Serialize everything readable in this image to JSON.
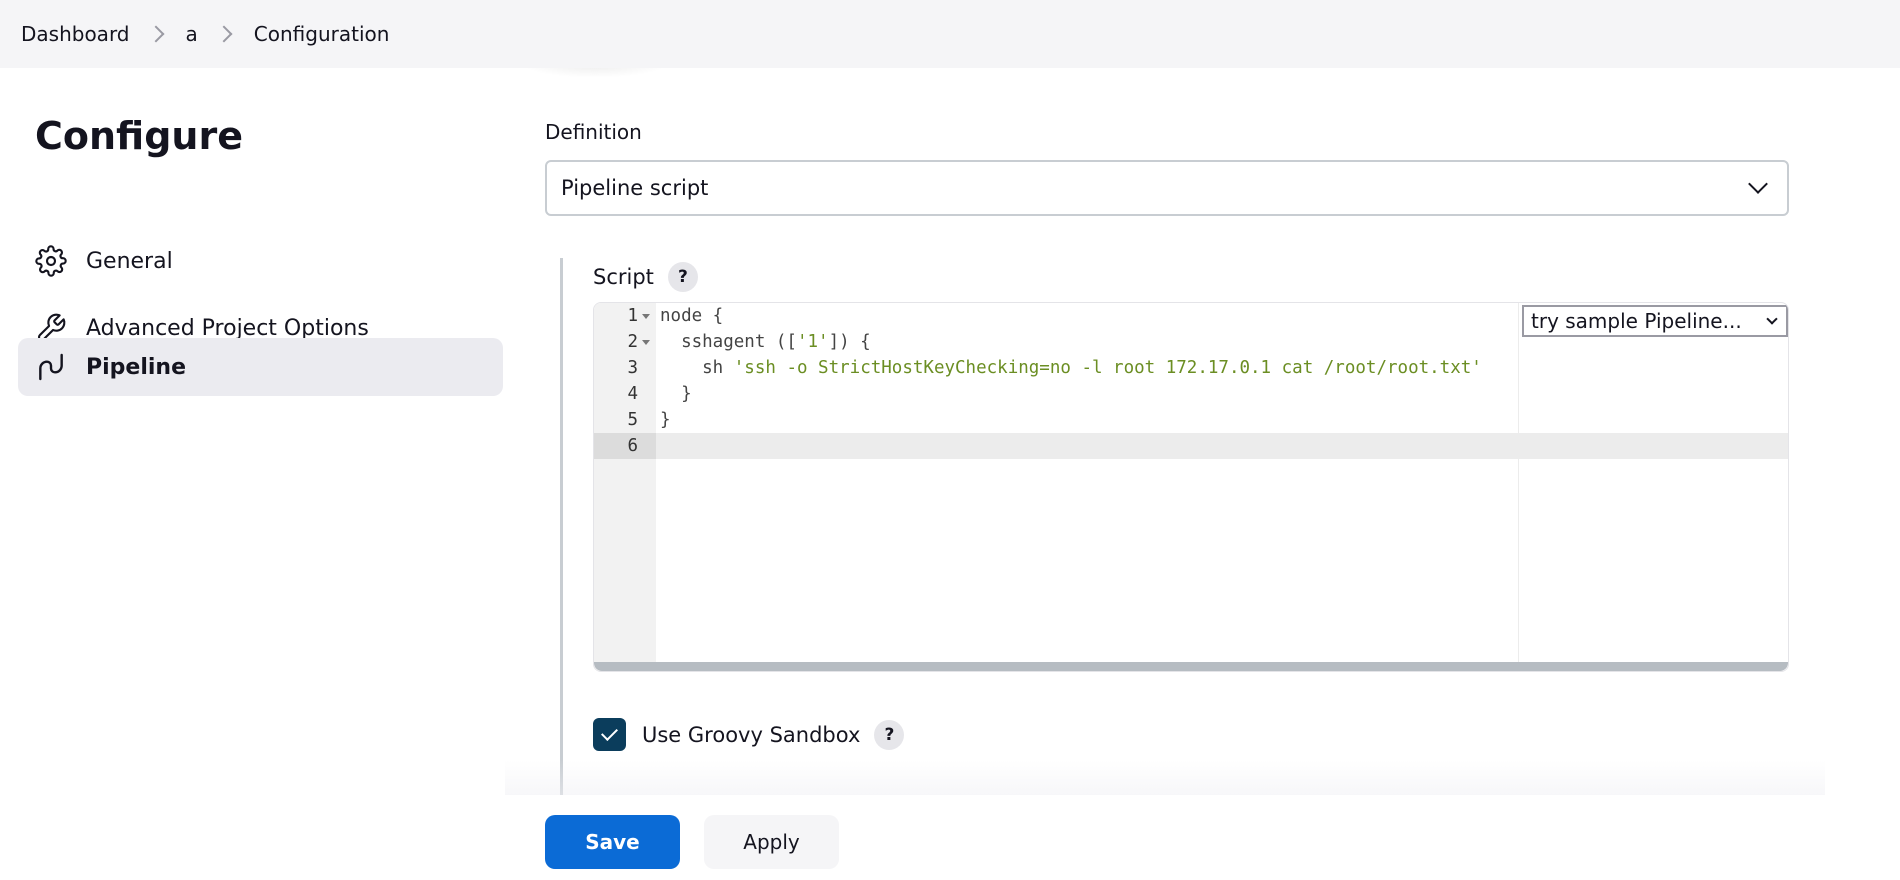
{
  "breadcrumb": {
    "items": [
      {
        "label": "Dashboard"
      },
      {
        "label": "a"
      },
      {
        "label": "Configuration"
      }
    ]
  },
  "sidebar": {
    "title": "Configure",
    "items": [
      {
        "label": "General",
        "icon": "gear-icon",
        "active": false
      },
      {
        "label": "Advanced Project Options",
        "icon": "wrench-icon",
        "active": false
      },
      {
        "label": "Pipeline",
        "icon": "pipeline-icon",
        "active": true
      }
    ]
  },
  "definition": {
    "label": "Definition",
    "selected": "Pipeline script"
  },
  "script": {
    "label": "Script",
    "help": "?",
    "sample_select": "try sample Pipeline...",
    "lines": [
      {
        "num": "1",
        "parts": [
          {
            "t": "node {",
            "cls": ""
          }
        ]
      },
      {
        "num": "2",
        "parts": [
          {
            "t": "  sshagent ([",
            "cls": ""
          },
          {
            "t": "'1'",
            "cls": "str"
          },
          {
            "t": "]) {",
            "cls": ""
          }
        ]
      },
      {
        "num": "3",
        "parts": [
          {
            "t": "    sh ",
            "cls": ""
          },
          {
            "t": "'ssh -o StrictHostKeyChecking=no -l root 172.17.0.1 cat /root/root.txt'",
            "cls": "str"
          }
        ]
      },
      {
        "num": "4",
        "parts": [
          {
            "t": "  }",
            "cls": ""
          }
        ]
      },
      {
        "num": "5",
        "parts": [
          {
            "t": "}",
            "cls": ""
          }
        ]
      },
      {
        "num": "6",
        "parts": [
          {
            "t": "",
            "cls": ""
          }
        ]
      }
    ],
    "active_line": 6
  },
  "sandbox": {
    "label": "Use Groovy Sandbox",
    "checked": true,
    "help": "?"
  },
  "footer": {
    "save_label": "Save",
    "apply_label": "Apply"
  },
  "colors": {
    "primary": "#0b6bd6",
    "checkbox": "#0b3d5c",
    "string": "#6b8e23"
  }
}
